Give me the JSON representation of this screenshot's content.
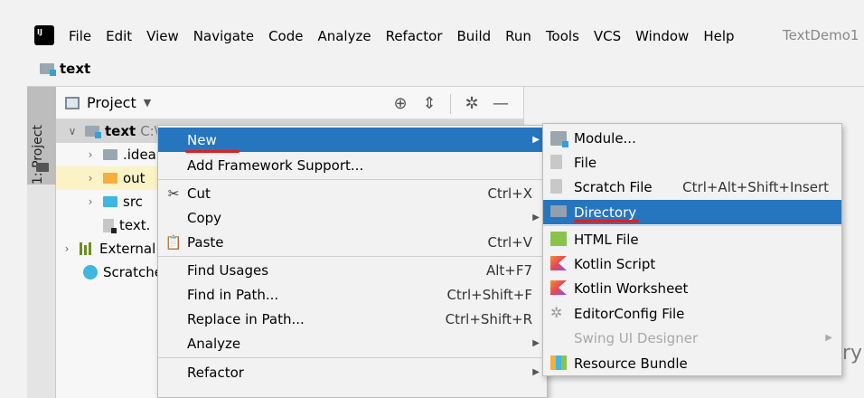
{
  "menubar": {
    "items": [
      "File",
      "Edit",
      "View",
      "Navigate",
      "Code",
      "Analyze",
      "Refactor",
      "Build",
      "Run",
      "Tools",
      "VCS",
      "Window",
      "Help"
    ],
    "window_title": "TextDemo1"
  },
  "navbar": {
    "label": "text"
  },
  "left_strip": {
    "label": "1: Project"
  },
  "project_panel": {
    "title": "Project",
    "tree": [
      {
        "label": "text",
        "suffix": "C:\\"
      },
      {
        "label": ".idea"
      },
      {
        "label": "out"
      },
      {
        "label": "src"
      },
      {
        "label": "text."
      },
      {
        "label": "External"
      },
      {
        "label": "Scratche"
      }
    ]
  },
  "context_menu": {
    "items": [
      {
        "label": "New",
        "shortcut": ""
      },
      {
        "label": "Add Framework Support...",
        "shortcut": ""
      },
      {
        "label": "Cut",
        "shortcut": "Ctrl+X"
      },
      {
        "label": "Copy",
        "shortcut": ""
      },
      {
        "label": "Paste",
        "shortcut": "Ctrl+V"
      },
      {
        "label": "Find Usages",
        "shortcut": "Alt+F7"
      },
      {
        "label": "Find in Path...",
        "shortcut": "Ctrl+Shift+F"
      },
      {
        "label": "Replace in Path...",
        "shortcut": "Ctrl+Shift+R"
      },
      {
        "label": "Analyze",
        "shortcut": ""
      },
      {
        "label": "Refactor",
        "shortcut": ""
      }
    ]
  },
  "new_submenu": {
    "items": [
      {
        "label": "Module...",
        "shortcut": ""
      },
      {
        "label": "File",
        "shortcut": ""
      },
      {
        "label": "Scratch File",
        "shortcut": "Ctrl+Alt+Shift+Insert"
      },
      {
        "label": "Directory",
        "shortcut": ""
      },
      {
        "label": "HTML File",
        "shortcut": ""
      },
      {
        "label": "Kotlin Script",
        "shortcut": ""
      },
      {
        "label": "Kotlin Worksheet",
        "shortcut": ""
      },
      {
        "label": "EditorConfig File",
        "shortcut": ""
      },
      {
        "label": "Swing UI Designer",
        "shortcut": ""
      },
      {
        "label": "Resource Bundle",
        "shortcut": ""
      }
    ]
  },
  "colors": {
    "selection": "#2675bf",
    "annotation_red": "#e02020"
  }
}
